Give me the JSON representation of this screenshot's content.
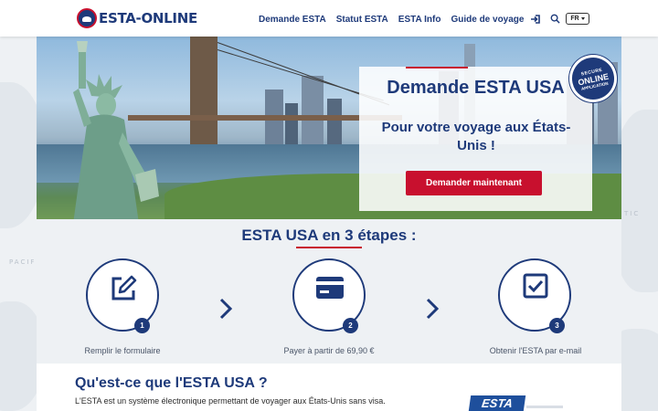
{
  "header": {
    "logo_text": "ESTA-ONLINE",
    "nav": [
      "Demande ESTA",
      "Statut ESTA",
      "ESTA Info",
      "Guide de voyage"
    ],
    "language": "FR"
  },
  "background": {
    "labels": [
      "PACIF",
      "TIC"
    ]
  },
  "hero": {
    "title": "Demande ESTA USA",
    "subtitle": "Pour votre voyage aux États-Unis !",
    "cta": "Demander maintenant",
    "badge": {
      "top": "SECURE",
      "middle": "ONLINE",
      "bottom": "APPLICATION"
    }
  },
  "steps": {
    "title": "ESTA USA en 3 étapes :",
    "items": [
      {
        "number": "1",
        "label": "Remplir le formulaire",
        "icon": "edit-form-icon"
      },
      {
        "number": "2",
        "label": "Payer à partir de 69,90 €",
        "icon": "credit-card-icon"
      },
      {
        "number": "3",
        "label": "Obtenir l'ESTA par e-mail",
        "icon": "checkbox-icon"
      }
    ]
  },
  "info": {
    "title": "Qu'est-ce que l'ESTA USA ?",
    "text": "L'ESTA est un système électronique permettant de voyager aux États-Unis sans visa.",
    "logo_text": "ESTA"
  },
  "colors": {
    "navy": "#1e3a7a",
    "red": "#c8102e",
    "background": "#eef1f4"
  }
}
